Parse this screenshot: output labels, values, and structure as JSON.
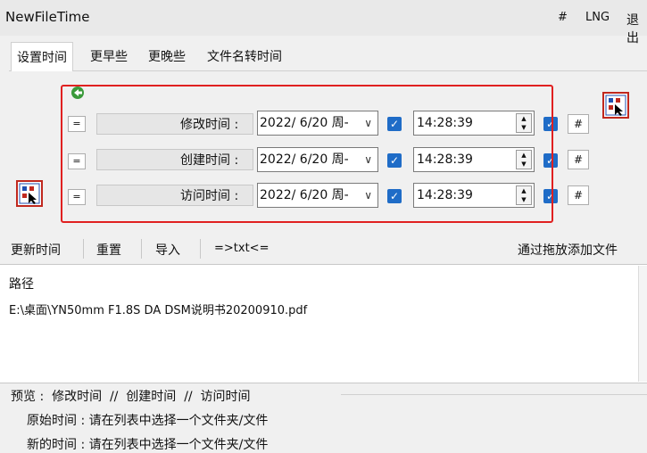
{
  "window": {
    "title": "NewFileTime",
    "hash_label": "#",
    "lng_label": "LNG",
    "exit_label": "退出"
  },
  "tabs": [
    {
      "label": "设置时间",
      "active": true
    },
    {
      "label": "更早些",
      "active": false
    },
    {
      "label": "更晚些",
      "active": false
    },
    {
      "label": "文件名转时间",
      "active": false
    }
  ],
  "time_rows": [
    {
      "eq_label": "=",
      "label": "修改时间 :",
      "date": "2022/ 6/20 周-",
      "checked": true,
      "time": "14:28:39",
      "hash_label": "#"
    },
    {
      "eq_label": "=",
      "label": "创建时间 :",
      "date": "2022/ 6/20 周-",
      "checked": true,
      "time": "14:28:39",
      "hash_label": "#"
    },
    {
      "eq_label": "=",
      "label": "访问时间 :",
      "date": "2022/ 6/20 周-",
      "checked": true,
      "time": "14:28:39",
      "hash_label": "#"
    }
  ],
  "toolbar": {
    "update_label": "更新时间",
    "reset_label": "重置",
    "import_label": "导入",
    "txt_label": "=>txt<=",
    "drag_label": "通过拖放添加文件"
  },
  "list": {
    "header": "路径",
    "items": [
      "E:\\桌面\\YN50mm F1.8S DA DSM说明书20200910.pdf"
    ]
  },
  "preview": {
    "header": "预览 :  修改时间  //  创建时间  //  访问时间",
    "original_label": "原始时间 : 请在列表中选择一个文件夹/文件",
    "new_label": "新的时间 : 请在列表中选择一个文件夹/文件"
  },
  "colors": {
    "highlight_border": "#e02020",
    "checkbox": "#1f6cc7"
  }
}
